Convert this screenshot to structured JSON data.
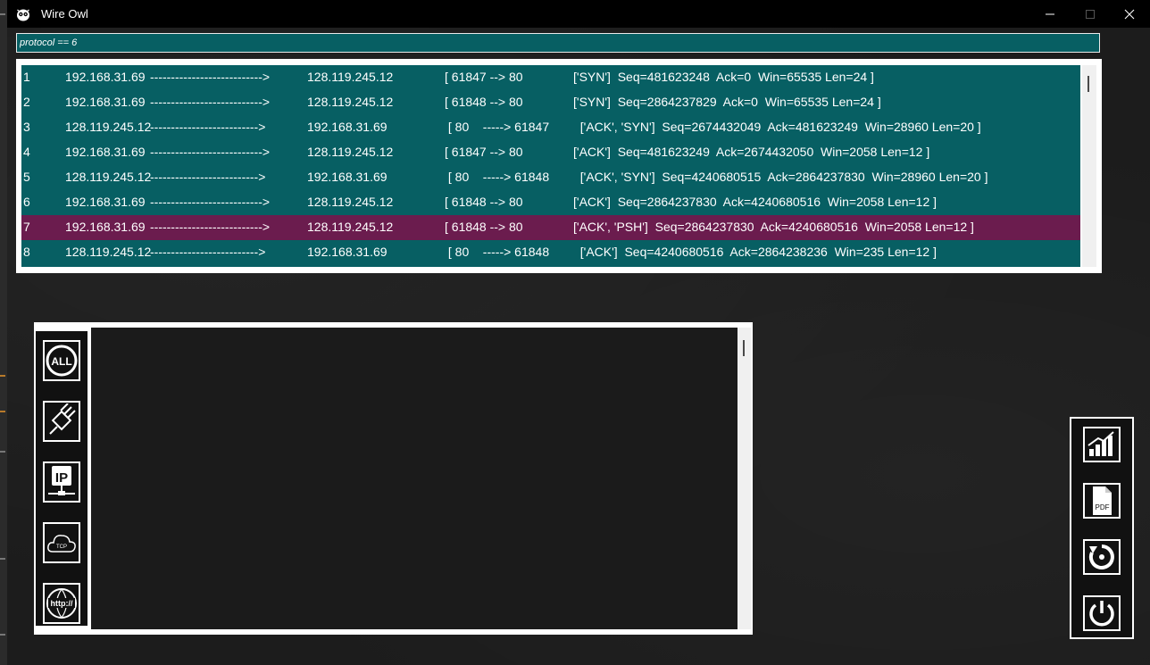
{
  "window": {
    "title": "Wire Owl"
  },
  "filter": {
    "value": "protocol == 6"
  },
  "packets": [
    {
      "no": "1",
      "src": "192.168.31.69",
      "arrow": "--------------------------->",
      "dst": "128.119.245.12",
      "ports": "[ 61847 --> 80",
      "flags": "['SYN']  Seq=481623248  Ack=0  Win=65535 Len=24 ]"
    },
    {
      "no": "2",
      "src": "192.168.31.69",
      "arrow": "--------------------------->",
      "dst": "128.119.245.12",
      "ports": "[ 61848 --> 80",
      "flags": "['SYN']  Seq=2864237829  Ack=0  Win=65535 Len=24 ]"
    },
    {
      "no": "3",
      "src": "128.119.245.12",
      "arrow": "-------------------------->",
      "dst": "192.168.31.69",
      "ports": " [ 80    -----> 61847",
      "flags": "  ['ACK', 'SYN']  Seq=2674432049  Ack=481623249  Win=28960 Len=20 ]"
    },
    {
      "no": "4",
      "src": "192.168.31.69",
      "arrow": "--------------------------->",
      "dst": "128.119.245.12",
      "ports": "[ 61847 --> 80",
      "flags": "['ACK']  Seq=481623249  Ack=2674432050  Win=2058 Len=12 ]"
    },
    {
      "no": "5",
      "src": "128.119.245.12",
      "arrow": "-------------------------->",
      "dst": "192.168.31.69",
      "ports": " [ 80    -----> 61848",
      "flags": "  ['ACK', 'SYN']  Seq=4240680515  Ack=2864237830  Win=28960 Len=20 ]"
    },
    {
      "no": "6",
      "src": "192.168.31.69",
      "arrow": "--------------------------->",
      "dst": "128.119.245.12",
      "ports": "[ 61848 --> 80",
      "flags": "['ACK']  Seq=2864237830  Ack=4240680516  Win=2058 Len=12 ]"
    },
    {
      "no": "7",
      "src": "192.168.31.69",
      "arrow": "--------------------------->",
      "dst": "128.119.245.12",
      "ports": "[ 61848 --> 80",
      "flags": "['ACK', 'PSH']  Seq=2864237830  Ack=4240680516  Win=2058 Len=12 ]"
    },
    {
      "no": "8",
      "src": "128.119.245.12",
      "arrow": "-------------------------->",
      "dst": "192.168.31.69",
      "ports": " [ 80    -----> 61848",
      "flags": "  ['ACK']  Seq=4240680516  Ack=2864238236  Win=235 Len=12 ]"
    }
  ],
  "selected_row": 6,
  "protocol_buttons": [
    {
      "name": "all-filter",
      "icon": "all-icon",
      "label": "ALL"
    },
    {
      "name": "ethernet-filter",
      "icon": "ethernet-cable-icon"
    },
    {
      "name": "ip-filter",
      "icon": "ip-network-icon",
      "label": "IP"
    },
    {
      "name": "tcp-filter",
      "icon": "tcp-cloud-icon",
      "label": "TCP"
    },
    {
      "name": "http-filter",
      "icon": "http-globe-icon",
      "label": "http://"
    }
  ],
  "tool_buttons": [
    {
      "name": "statistics",
      "icon": "bar-chart-icon"
    },
    {
      "name": "export-pdf",
      "icon": "pdf-file-icon",
      "label": "PDF"
    },
    {
      "name": "restart",
      "icon": "restart-icon"
    },
    {
      "name": "power",
      "icon": "power-icon"
    }
  ],
  "colors": {
    "row_bg": "#075f63",
    "selected_bg": "#6b1c4e",
    "surface": "#1c1c1c"
  }
}
